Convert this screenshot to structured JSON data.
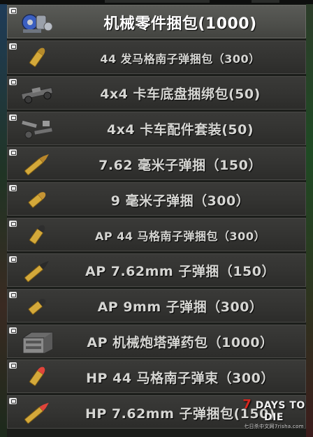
{
  "items": [
    {
      "name": "机械零件捆包(1000)",
      "icon": "mechanical-parts-icon"
    },
    {
      "name": "44 发马格南子弹捆包（300）",
      "icon": "magnum-bullet-icon"
    },
    {
      "name": "4x4 卡车底盘捆绑包(50)",
      "icon": "truck-chassis-icon"
    },
    {
      "name": "4x4 卡车配件套装(50)",
      "icon": "truck-accessories-icon"
    },
    {
      "name": "7.62 毫米子弹捆（150）",
      "icon": "rifle-round-icon"
    },
    {
      "name": "9 毫米子弹捆（300）",
      "icon": "pistol-round-icon"
    },
    {
      "name": "AP 44 马格南子弹捆包（300）",
      "icon": "ap-magnum-bullet-icon"
    },
    {
      "name": "AP 7.62mm 子弹捆（150）",
      "icon": "ap-rifle-round-icon"
    },
    {
      "name": "AP 9mm 子弹捆（300）",
      "icon": "ap-pistol-round-icon"
    },
    {
      "name": "AP 机械炮塔弹药包（1000）",
      "icon": "turret-ammo-box-icon"
    },
    {
      "name": "HP 44 马格南子弹束（300）",
      "icon": "hp-magnum-bullet-icon"
    },
    {
      "name": "HP 7.62mm 子弹捆包(150)",
      "icon": "hp-rifle-round-icon"
    }
  ],
  "watermark": {
    "title_num": "7",
    "title_text": "DAYS TO DIE",
    "subtitle": "七日杀中文网7risha.com"
  },
  "colors": {
    "row_bg": "#353533",
    "row_selected_bg": "#4f504c",
    "text": "#d6d6d3",
    "brass": "#d4a93a",
    "hp_tip": "#e0443a"
  }
}
